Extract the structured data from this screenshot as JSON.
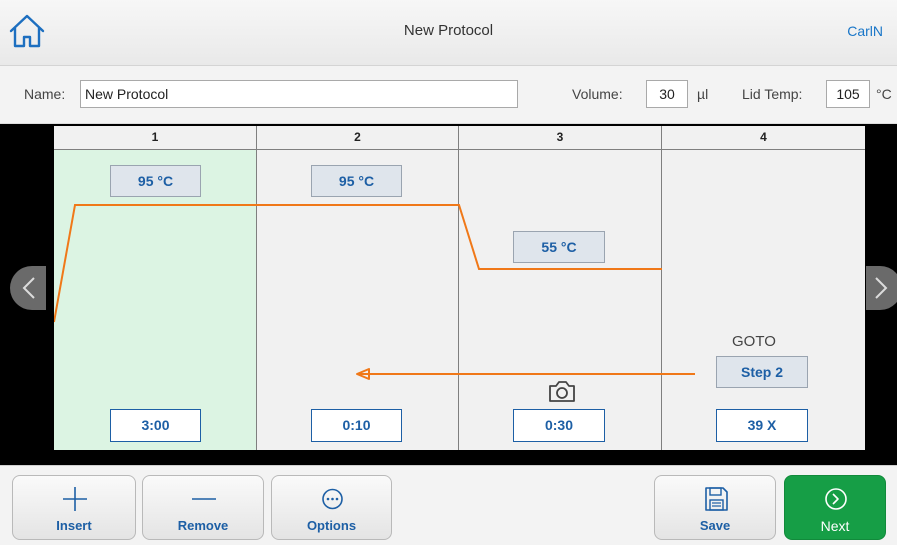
{
  "header": {
    "title": "New Protocol",
    "user": "CarlN",
    "home_icon": "home-icon"
  },
  "form": {
    "name_label": "Name:",
    "name_value": "New Protocol",
    "volume_label": "Volume:",
    "volume_value": "30",
    "volume_unit": "µl",
    "lid_label": "Lid Temp:",
    "lid_value": "105",
    "lid_unit": "°C"
  },
  "steps": [
    {
      "number": "1",
      "temperature": "95 °C",
      "time": "3:00",
      "selected": true
    },
    {
      "number": "2",
      "temperature": "95 °C",
      "time": "0:10"
    },
    {
      "number": "3",
      "temperature": "55 °C",
      "time": "0:30",
      "camera_icon": "camera-icon"
    },
    {
      "number": "4",
      "goto_label": "GOTO",
      "goto_target": "Step 2",
      "cycles": "39 X"
    }
  ],
  "navigation": {
    "prev_icon": "chevron-left-icon",
    "next_icon": "chevron-right-icon"
  },
  "toolbar": {
    "insert_label": "Insert",
    "remove_label": "Remove",
    "options_label": "Options",
    "save_label": "Save",
    "next_label": "Next",
    "accent_color": "#1d5fa5",
    "next_color": "#169e46",
    "trace_color": "#f07818"
  }
}
